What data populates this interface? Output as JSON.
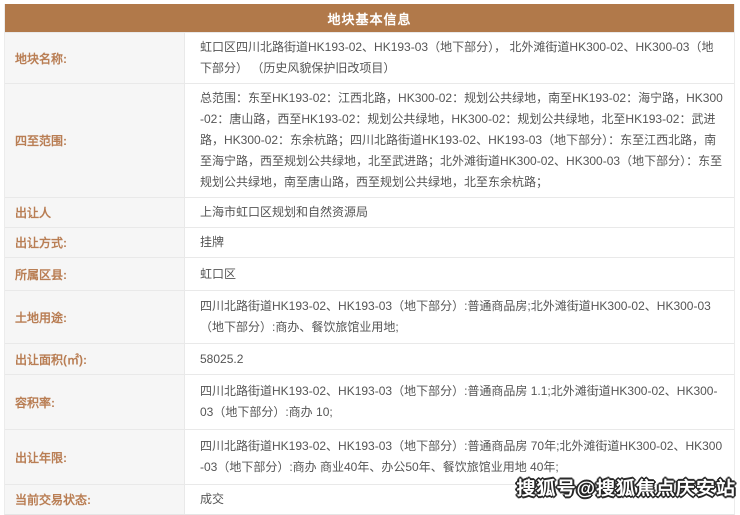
{
  "table": {
    "title": "地块基本信息",
    "rows": [
      {
        "label": "地块名称:",
        "value": "虹口区四川北路街道HK193-02、HK193-03（地下部分）， 北外滩街道HK300-02、HK300-03（地下部分） （历史风貌保护旧改项目）"
      },
      {
        "label": "四至范围:",
        "value": "总范围：东至HK193-02：江西北路，HK300-02：规划公共绿地，南至HK193-02：海宁路，HK300-02：唐山路，西至HK193-02：规划公共绿地，HK300-02：规划公共绿地，北至HK193-02：武进路，HK300-02：东余杭路；四川北路街道HK193-02、HK193-03（地下部分）：东至江西北路，南至海宁路，西至规划公共绿地，北至武进路；北外滩街道HK300-02、HK300-03（地下部分）：东至规划公共绿地，南至唐山路，西至规划公共绿地，北至东余杭路；"
      },
      {
        "label": "出让人",
        "value": "上海市虹口区规划和自然资源局"
      },
      {
        "label": "出让方式:",
        "value": "挂牌"
      },
      {
        "label": "所属区县:",
        "value": "虹口区"
      },
      {
        "label": "土地用途:",
        "value": "四川北路街道HK193-02、HK193-03（地下部分）:普通商品房;北外滩街道HK300-02、HK300-03（地下部分）:商办、餐饮旅馆业用地;"
      },
      {
        "label": "出让面积(㎡):",
        "value": "58025.2"
      },
      {
        "label": "容积率:",
        "value": "四川北路街道HK193-02、HK193-03（地下部分）:普通商品房 1.1;北外滩街道HK300-02、HK300-03（地下部分）:商办 10;"
      },
      {
        "label": "出让年限:",
        "value": "四川北路街道HK193-02、HK193-03（地下部分）:普通商品房 70年;北外滩街道HK300-02、HK300-03（地下部分）:商办 商业40年、办公50年、餐饮旅馆业用地 40年;"
      },
      {
        "label": "当前交易状态:",
        "value": "成交"
      }
    ]
  },
  "watermark": "搜狐号@搜狐焦点庆安站",
  "colors": {
    "header_bg": "#b1794a",
    "label_text": "#b97e54",
    "label_bg": "#f6f6f6",
    "value_text": "#555555",
    "border": "#e9e9e9"
  }
}
